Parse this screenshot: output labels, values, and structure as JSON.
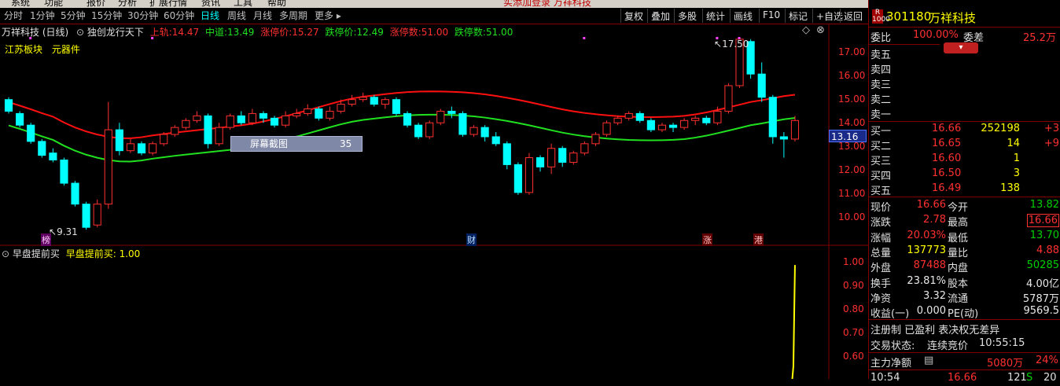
{
  "menu": {
    "items": [
      "系统",
      "功能",
      "报价",
      "分析",
      "扩展行情",
      "资讯",
      "工具",
      "帮助"
    ],
    "center_text": "实添加登录 万祥科技"
  },
  "toolbar": {
    "periods": [
      "分时",
      "1分钟",
      "5分钟",
      "15分钟",
      "30分钟",
      "60分钟",
      "日线",
      "周线",
      "月线",
      "多周期",
      "更多 ▸"
    ],
    "active_period": "日线",
    "right_buttons": [
      "复权",
      "叠加",
      "多股",
      "统计",
      "画线",
      "F10",
      "标记",
      "+自选",
      "返回"
    ]
  },
  "chart": {
    "title": "万祥科技 (日线)",
    "indicator_name": "独创龙行天下",
    "upper": {
      "label": "上轨:",
      "value": "14.47"
    },
    "middle": {
      "label": "中道:",
      "value": "13.49"
    },
    "limit_up": {
      "label": "涨停价:",
      "value": "15.27"
    },
    "limit_down": {
      "label": "跌停价:",
      "value": "12.49"
    },
    "limit_up_count": {
      "label": "涨停数:",
      "value": "51.00"
    },
    "limit_down_count": {
      "label": "跌停数:",
      "value": "51.00"
    },
    "sector": "江苏板块",
    "industry": "元器件",
    "price_axis": [
      "17.00",
      "16.00",
      "15.00",
      "14.00",
      "13.00",
      "12.00",
      "11.00",
      "10.00"
    ],
    "current_price_tag": "13.16",
    "high_marker": "17.50",
    "low_marker": "9.31",
    "screenshot_label": "屏幕截图",
    "screenshot_value": "35",
    "event_marks": [
      "榜",
      "财",
      "涨",
      "港"
    ],
    "lower_title": "早盘提前买",
    "lower_value_label": "早盘提前买: 1.00",
    "lower_axis": [
      "1.00",
      "0.90",
      "0.80",
      "0.70",
      "0.60"
    ]
  },
  "chart_data": {
    "type": "candlestick",
    "x_range": [
      0,
      71
    ],
    "ylim": [
      9.0,
      17.8
    ],
    "candles": [
      [
        0,
        14.9,
        14.4,
        15.0,
        14.3
      ],
      [
        1,
        14.3,
        13.8,
        14.4,
        13.7
      ],
      [
        2,
        13.8,
        13.1,
        13.9,
        13.0
      ],
      [
        3,
        13.1,
        12.5,
        13.2,
        12.4
      ],
      [
        4,
        12.6,
        12.3,
        12.8,
        12.2
      ],
      [
        5,
        12.3,
        11.3,
        12.4,
        11.2
      ],
      [
        6,
        11.3,
        10.4,
        11.4,
        10.3
      ],
      [
        7,
        10.4,
        9.4,
        10.5,
        9.3
      ],
      [
        8,
        9.5,
        10.4,
        10.6,
        9.4
      ],
      [
        9,
        10.4,
        13.6,
        14.8,
        10.2
      ],
      [
        10,
        13.6,
        12.7,
        13.9,
        12.5
      ],
      [
        11,
        12.7,
        13.0,
        13.2,
        12.6
      ],
      [
        12,
        13.0,
        12.6,
        13.1,
        12.5
      ],
      [
        13,
        12.6,
        13.0,
        13.1,
        12.5
      ],
      [
        14,
        13.0,
        13.4,
        13.5,
        12.9
      ],
      [
        15,
        13.4,
        13.7,
        13.8,
        13.3
      ],
      [
        16,
        13.7,
        14.0,
        14.1,
        13.6
      ],
      [
        17,
        14.0,
        14.2,
        14.4,
        13.9
      ],
      [
        18,
        14.2,
        13.0,
        14.3,
        12.8
      ],
      [
        19,
        13.0,
        13.7,
        13.9,
        12.9
      ],
      [
        20,
        13.7,
        14.2,
        14.3,
        13.6
      ],
      [
        21,
        14.2,
        13.9,
        14.4,
        13.8
      ],
      [
        22,
        13.9,
        14.3,
        14.5,
        13.8
      ],
      [
        23,
        14.3,
        14.1,
        14.4,
        13.9
      ],
      [
        24,
        14.1,
        13.8,
        14.2,
        13.7
      ],
      [
        25,
        13.8,
        14.2,
        14.4,
        13.7
      ],
      [
        26,
        14.2,
        14.3,
        14.5,
        14.1
      ],
      [
        27,
        14.3,
        14.5,
        14.7,
        14.2
      ],
      [
        28,
        14.5,
        14.1,
        14.6,
        14.0
      ],
      [
        29,
        14.1,
        14.4,
        14.6,
        14.0
      ],
      [
        30,
        14.4,
        14.7,
        14.9,
        14.3
      ],
      [
        31,
        14.7,
        14.9,
        15.1,
        14.6
      ],
      [
        32,
        14.9,
        15.0,
        15.2,
        14.8
      ],
      [
        33,
        15.0,
        14.7,
        15.1,
        14.6
      ],
      [
        34,
        14.7,
        14.9,
        15.0,
        14.5
      ],
      [
        35,
        14.9,
        14.3,
        15.0,
        14.2
      ],
      [
        36,
        14.3,
        13.8,
        14.4,
        13.7
      ],
      [
        37,
        13.8,
        13.3,
        13.9,
        13.2
      ],
      [
        38,
        13.3,
        13.9,
        14.0,
        13.2
      ],
      [
        39,
        13.9,
        14.4,
        14.5,
        13.8
      ],
      [
        40,
        14.4,
        14.3,
        14.6,
        14.1
      ],
      [
        41,
        14.3,
        13.4,
        14.4,
        13.3
      ],
      [
        42,
        13.4,
        13.7,
        13.8,
        13.3
      ],
      [
        43,
        13.7,
        13.3,
        13.8,
        13.1
      ],
      [
        44,
        13.3,
        13.0,
        13.5,
        12.9
      ],
      [
        45,
        13.0,
        12.1,
        13.1,
        11.9
      ],
      [
        46,
        12.1,
        10.9,
        12.2,
        10.8
      ],
      [
        47,
        10.9,
        12.4,
        12.6,
        10.8
      ],
      [
        48,
        12.4,
        12.0,
        12.5,
        11.8
      ],
      [
        49,
        12.0,
        12.8,
        13.0,
        11.7
      ],
      [
        50,
        12.8,
        12.2,
        12.9,
        12.0
      ],
      [
        51,
        12.2,
        12.6,
        12.7,
        12.1
      ],
      [
        52,
        12.6,
        13.0,
        13.1,
        12.5
      ],
      [
        53,
        13.0,
        13.4,
        13.5,
        12.9
      ],
      [
        54,
        13.4,
        13.9,
        14.0,
        13.3
      ],
      [
        55,
        13.9,
        14.1,
        14.2,
        13.8
      ],
      [
        56,
        14.1,
        14.3,
        14.4,
        14.0
      ],
      [
        57,
        14.3,
        14.0,
        14.4,
        13.9
      ],
      [
        58,
        14.0,
        13.6,
        14.1,
        13.5
      ],
      [
        59,
        13.6,
        13.8,
        13.9,
        13.5
      ],
      [
        60,
        13.8,
        13.7,
        13.9,
        13.5
      ],
      [
        61,
        13.7,
        14.0,
        14.1,
        13.6
      ],
      [
        62,
        14.0,
        14.1,
        14.2,
        13.8
      ],
      [
        63,
        14.1,
        13.9,
        14.2,
        13.8
      ],
      [
        64,
        13.9,
        14.4,
        14.6,
        13.8
      ],
      [
        65,
        14.4,
        15.5,
        15.6,
        14.3
      ],
      [
        66,
        15.5,
        17.5,
        17.5,
        15.4
      ],
      [
        67,
        17.4,
        16.0,
        17.5,
        15.8
      ],
      [
        68,
        16.0,
        15.0,
        16.5,
        14.8
      ],
      [
        69,
        15.0,
        13.3,
        15.1,
        13.0
      ],
      [
        70,
        13.3,
        13.2,
        13.5,
        12.4
      ],
      [
        71,
        13.2,
        14.0,
        14.2,
        13.1
      ]
    ],
    "lower_series": {
      "name": "早盘提前买",
      "ylim": [
        0.55,
        1.05
      ],
      "last_value": 1.0
    }
  },
  "quote": {
    "code": "301180",
    "name": "万祥科技",
    "webi_label": "委比",
    "webi_value": "100.00%",
    "wecha_label": "委差",
    "wecha_value": "25.2万",
    "asks": [
      {
        "label": "卖五",
        "price": "",
        "volume": "",
        "change": ""
      },
      {
        "label": "卖四",
        "price": "",
        "volume": "",
        "change": ""
      },
      {
        "label": "卖三",
        "price": "",
        "volume": "",
        "change": ""
      },
      {
        "label": "卖二",
        "price": "",
        "volume": "",
        "change": ""
      },
      {
        "label": "卖一",
        "price": "",
        "volume": "",
        "change": ""
      }
    ],
    "bids": [
      {
        "label": "买一",
        "price": "16.66",
        "volume": "252198",
        "change": "+3"
      },
      {
        "label": "买二",
        "price": "16.65",
        "volume": "14",
        "change": "+9"
      },
      {
        "label": "买三",
        "price": "16.60",
        "volume": "1",
        "change": ""
      },
      {
        "label": "买四",
        "price": "16.50",
        "volume": "3",
        "change": ""
      },
      {
        "label": "买五",
        "price": "16.49",
        "volume": "138",
        "change": ""
      }
    ],
    "stats": [
      {
        "l1": "现价",
        "v1": "16.66",
        "c1": "red",
        "l2": "今开",
        "v2": "13.82",
        "c2": "green"
      },
      {
        "l1": "涨跌",
        "v1": "2.78",
        "c1": "red",
        "l2": "最高",
        "v2": "16.66",
        "c2": "red"
      },
      {
        "l1": "涨幅",
        "v1": "20.03%",
        "c1": "red",
        "l2": "最低",
        "v2": "13.70",
        "c2": "green"
      },
      {
        "l1": "总量",
        "v1": "137773",
        "c1": "yellow",
        "l2": "量比",
        "v2": "4.88",
        "c2": "red"
      },
      {
        "l1": "外盘",
        "v1": "87488",
        "c1": "red",
        "l2": "内盘",
        "v2": "50285",
        "c2": "green"
      },
      {
        "l1": "换手",
        "v1": "23.81%",
        "c1": "white",
        "l2": "股本",
        "v2": "4.00亿",
        "c2": "white"
      },
      {
        "l1": "净资",
        "v1": "3.32",
        "c1": "white",
        "l2": "流通",
        "v2": "5787万",
        "c2": "white"
      },
      {
        "l1": "收益(一)",
        "v1": "0.000",
        "c1": "white",
        "l2": "PE(动)",
        "v2": "9569.5",
        "c2": "white"
      }
    ],
    "registration": "注册制 已盈利 表决权无差异",
    "status_label": "交易状态:",
    "status_value": "连续竞价",
    "status_time": "10:55:15",
    "main_flow_label": "主力净额",
    "main_flow_value": "5080万",
    "main_flow_pct": "24%",
    "tick_time": "10:54",
    "tick_price": "16.66",
    "tick_vol": "121",
    "tick_dir": "S",
    "tick_n": "20"
  },
  "colors": {
    "up": "#ff3030",
    "down": "#00ffff",
    "ma_red": "#ff1010",
    "ma_green": "#20e020",
    "frame": "#800000"
  }
}
